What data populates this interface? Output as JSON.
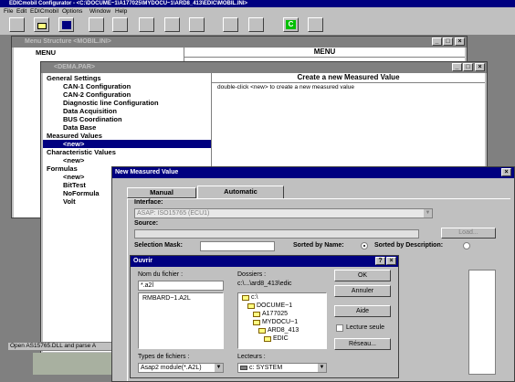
{
  "app": {
    "title": "EDICmobil Configurator - <C:\\DOCUME~1\\A177025\\MYDOCU~1\\ARD8_413\\EDIC\\MOBIL.INI>"
  },
  "menubar": [
    "File",
    "Edit",
    "EDICmobil",
    "Options",
    "Window",
    "Help"
  ],
  "menu_structure": {
    "title": "Menu Structure <MOBIL.INI>",
    "root": "MENU",
    "header": "MENU"
  },
  "dema": {
    "title": "<DEMA.PAR>",
    "tree": [
      "General Settings",
      "CAN-1 Configuration",
      "CAN-2 Configuration",
      "Diagnostic line Configuration",
      "Data Acquisition",
      "BUS Coordination",
      "Data Base",
      "Measured Values",
      "<new>",
      "Characteristic Values",
      "<new>",
      "Formulas",
      "<new>",
      "BitTest",
      "NoFormula",
      "Volt"
    ],
    "panel_title": "Create a new Measured Value",
    "panel_text": "double-click <new> to create a new measured value"
  },
  "dialog": {
    "title": "New Measured Value",
    "tabs": [
      "Manual",
      "Automatic"
    ],
    "interface_label": "Interface:",
    "interface_value": "ASAP: ISO15765 (ECU1)",
    "source_label": "Source:",
    "load_label": "Load...",
    "selection_mask_label": "Selection Mask:",
    "sorted_name": "Sorted by Name:",
    "sorted_desc": "Sorted by Description:"
  },
  "ouvrir": {
    "title": "Ouvrir",
    "file_label": "Nom du fichier :",
    "file_value": "*.a2l",
    "files": [
      "RMBARD~1.A2L"
    ],
    "folders_label": "Dossiers :",
    "folders_path": "c:\\...\\ard8_413\\edic",
    "folders": [
      "c:\\",
      "DOCUME~1",
      "A177025",
      "MYDOCU~1",
      "ARD8_413",
      "EDIC"
    ],
    "ok": "OK",
    "cancel": "Annuler",
    "help": "Aide",
    "readonly": "Lecture seule",
    "network": "Réseau...",
    "types_label": "Types de fichiers :",
    "types_value": "Asap2 module(*.A2L)",
    "drives_label": "Lecteurs :",
    "drives_value": "c: SYSTEM"
  },
  "status": {
    "text": "Open AS15765.DLL and parse A"
  }
}
